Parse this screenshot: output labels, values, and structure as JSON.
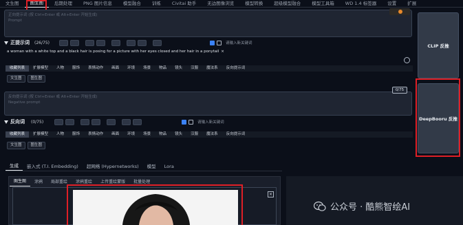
{
  "top_tabs": [
    "文生图",
    "图生图",
    "后期处理",
    "PNG 图片信息",
    "模型融合",
    "训练",
    "Civitai 助手",
    "无边图像浏览",
    "模型转换",
    "超级模型融合",
    "模型工具箱",
    "WD 1.4 标签器",
    "设置",
    "扩展"
  ],
  "prompt": {
    "placeholder_line1": "正向提示词 (按 Ctrl+Enter 或 Alt+Enter 开始生成)",
    "placeholder_line2": "Prompt",
    "label": "正提示词",
    "count": "(26/75)",
    "keyword_placeholder": "请输入新关键词",
    "tag_text": "a woman with a white top and a black hair is posing for a picture with her eyes closed and her hair in a ponytail",
    "tag_close": "×"
  },
  "categories": [
    "收藏列表",
    "扩展模型",
    "人物",
    "服饰",
    "表情动作",
    "画面",
    "环境",
    "场景",
    "物品",
    "镜头",
    "汉服",
    "魔法系",
    "反向提示词"
  ],
  "sub_tabs": [
    "文生图",
    "图生图"
  ],
  "negative": {
    "placeholder_line1": "反向提示词 (按 Ctrl+Enter 或 Alt+Enter 开始生成)",
    "placeholder_line2": "Negative prompt",
    "label": "反向词",
    "count": "(0/75)",
    "badge": "0/75",
    "keyword_placeholder": "请输入新关键词"
  },
  "buttons": {
    "clip": "CLIP 反推",
    "deepbooru": "DeepBooru 反推"
  },
  "mode_tabs": [
    "生成",
    "嵌入式 (T.I. Embedding)",
    "超网络 (Hypernetworks)",
    "模型",
    "Lora"
  ],
  "img2img_tabs": [
    "图生图",
    "涂鸦",
    "局部重绘",
    "涂鸦重绘",
    "上传重绘蒙版",
    "批量处理"
  ],
  "image_close": "×",
  "watermark": "公众号 · 酷熊智绘AI"
}
